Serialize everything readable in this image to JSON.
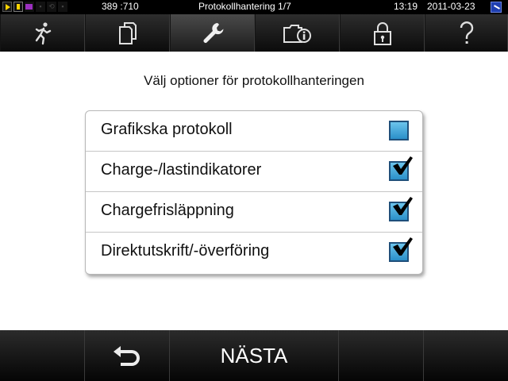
{
  "status_bar": {
    "counter": "389 :710",
    "title": "Protokollhantering 1/7",
    "time": "13:19",
    "date": "2011-03-23",
    "icons": [
      "play-icon",
      "card-icon",
      "magazine-icon",
      "device-icon",
      "sync-icon",
      "lock-icon"
    ]
  },
  "tabs": [
    {
      "icon": "running-person-icon",
      "active": false
    },
    {
      "icon": "documents-icon",
      "active": false
    },
    {
      "icon": "wrench-icon",
      "active": true
    },
    {
      "icon": "folder-info-icon",
      "active": false
    },
    {
      "icon": "padlock-icon",
      "active": false
    },
    {
      "icon": "question-icon",
      "active": false
    }
  ],
  "main": {
    "heading": "Välj optioner för protokollhanteringen",
    "options": [
      {
        "label": "Grafikska protokoll",
        "checked": false
      },
      {
        "label": "Charge-/lastindikatorer",
        "checked": true
      },
      {
        "label": "Chargefrisläppning",
        "checked": true
      },
      {
        "label": "Direktutskrift/-överföring",
        "checked": true
      }
    ]
  },
  "bottom_bar": {
    "back_icon": "back-arrow-icon",
    "next_label": "NÄSTA"
  },
  "colors": {
    "checkbox_fill": "#3ea4d8",
    "bar_background": "#111111",
    "status_icon_yellow": "#ffd400"
  }
}
